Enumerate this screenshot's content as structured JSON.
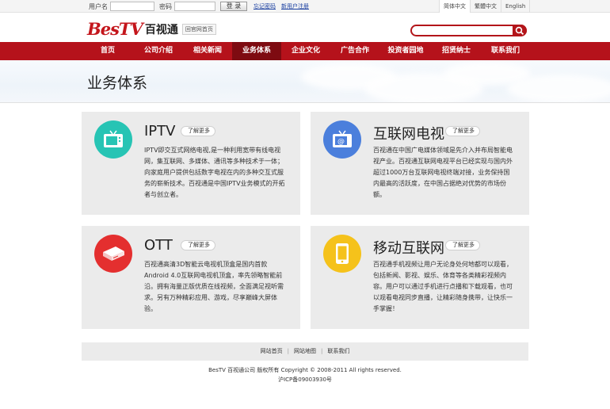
{
  "topbar": {
    "username_label": "用户名",
    "password_label": "密码",
    "login_button": "登 录",
    "forgot_link": "忘记密码",
    "register_link": "新用户注册",
    "languages": [
      "简体中文",
      "繁體中文",
      "English"
    ]
  },
  "header": {
    "logo_en": "BesTV",
    "logo_cn": "百视通",
    "back_home": "回官网首页",
    "search_placeholder": ""
  },
  "nav": {
    "items": [
      "首页",
      "公司介绍",
      "相关新闻",
      "业务体系",
      "企业文化",
      "广告合作",
      "投资者园地",
      "招贤纳士",
      "联系我们"
    ],
    "active": "业务体系"
  },
  "banner": {
    "title": "业务体系"
  },
  "cards": [
    {
      "title": "IPTV",
      "more": "了解更多",
      "icon": "tv-icon",
      "color": "#27c4b4",
      "desc": "IPTV即交互式网络电视,是一种利用宽带有线电视网，集互联网、多媒体、通讯等多种技术于一体；向家庭用户提供包括数字电视在内的多种交互式服务的崭新技术。百视通是中国IPTV业务模式的开拓者与创立者。"
    },
    {
      "title": "互联网电视",
      "more": "了解更多",
      "icon": "internet-tv-icon",
      "color": "#4b7fdc",
      "desc": "百视通在中国广电媒体领域是先介入并布局智能电视产业。百视通互联网电视平台已经实现与国内外超过1000万台互联网电视终端对接，业务保持国内最高的活跃度，在中国占据绝对优势的市场份额。"
    },
    {
      "title": "OTT",
      "more": "了解更多",
      "icon": "set-top-box-icon",
      "color": "#e42f2f",
      "desc": "百视通高清3D智能云电视机顶盒是国内首款Android 4.0互联网电视机顶盒，率先领略智能前沿。拥有海量正版优质在线视频，全面满足视听需求。另有万种精彩应用、游戏，尽享巅峰大屏体验。"
    },
    {
      "title": "移动互联网",
      "more": "了解更多",
      "icon": "mobile-phone-icon",
      "color": "#f5c21b",
      "desc": "百视通手机视频让用户无论身处何地都可以观看，包括新闻、影视、娱乐、体育等各类精彩视频内容。用户可以通过手机进行点播和下载观看，也可以观看电视同步直播，让精彩随身携带，让快乐一手掌握！"
    }
  ],
  "footer": {
    "links": [
      "网站首页",
      "网站地图",
      "联系我们"
    ],
    "copyright": "BesTV 百视通公司 版权所有 Copyright © 2008-2011 All rights reserved.",
    "icp": "沪ICP备09003930号"
  }
}
